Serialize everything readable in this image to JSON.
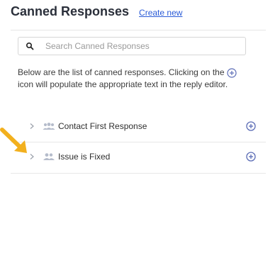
{
  "header": {
    "title": "Canned Responses",
    "create_label": "Create new"
  },
  "search": {
    "placeholder": "Search Canned Responses",
    "value": ""
  },
  "description": "Below are the list of canned responses. Clicking on the",
  "description_tail": "icon will populate the appropriate text in the reply editor.",
  "items": [
    {
      "label": "Contact First Response"
    },
    {
      "label": "Issue is Fixed"
    }
  ],
  "colors": {
    "accent": "#2a5bd7",
    "icon": "#5a6bb5",
    "people": "#b5bccb",
    "arrow": "#f2b01e"
  },
  "icons": {
    "search": "search-icon",
    "add": "plus-circle-icon",
    "chevron": "chevron-right-icon",
    "group": "people-icon"
  }
}
